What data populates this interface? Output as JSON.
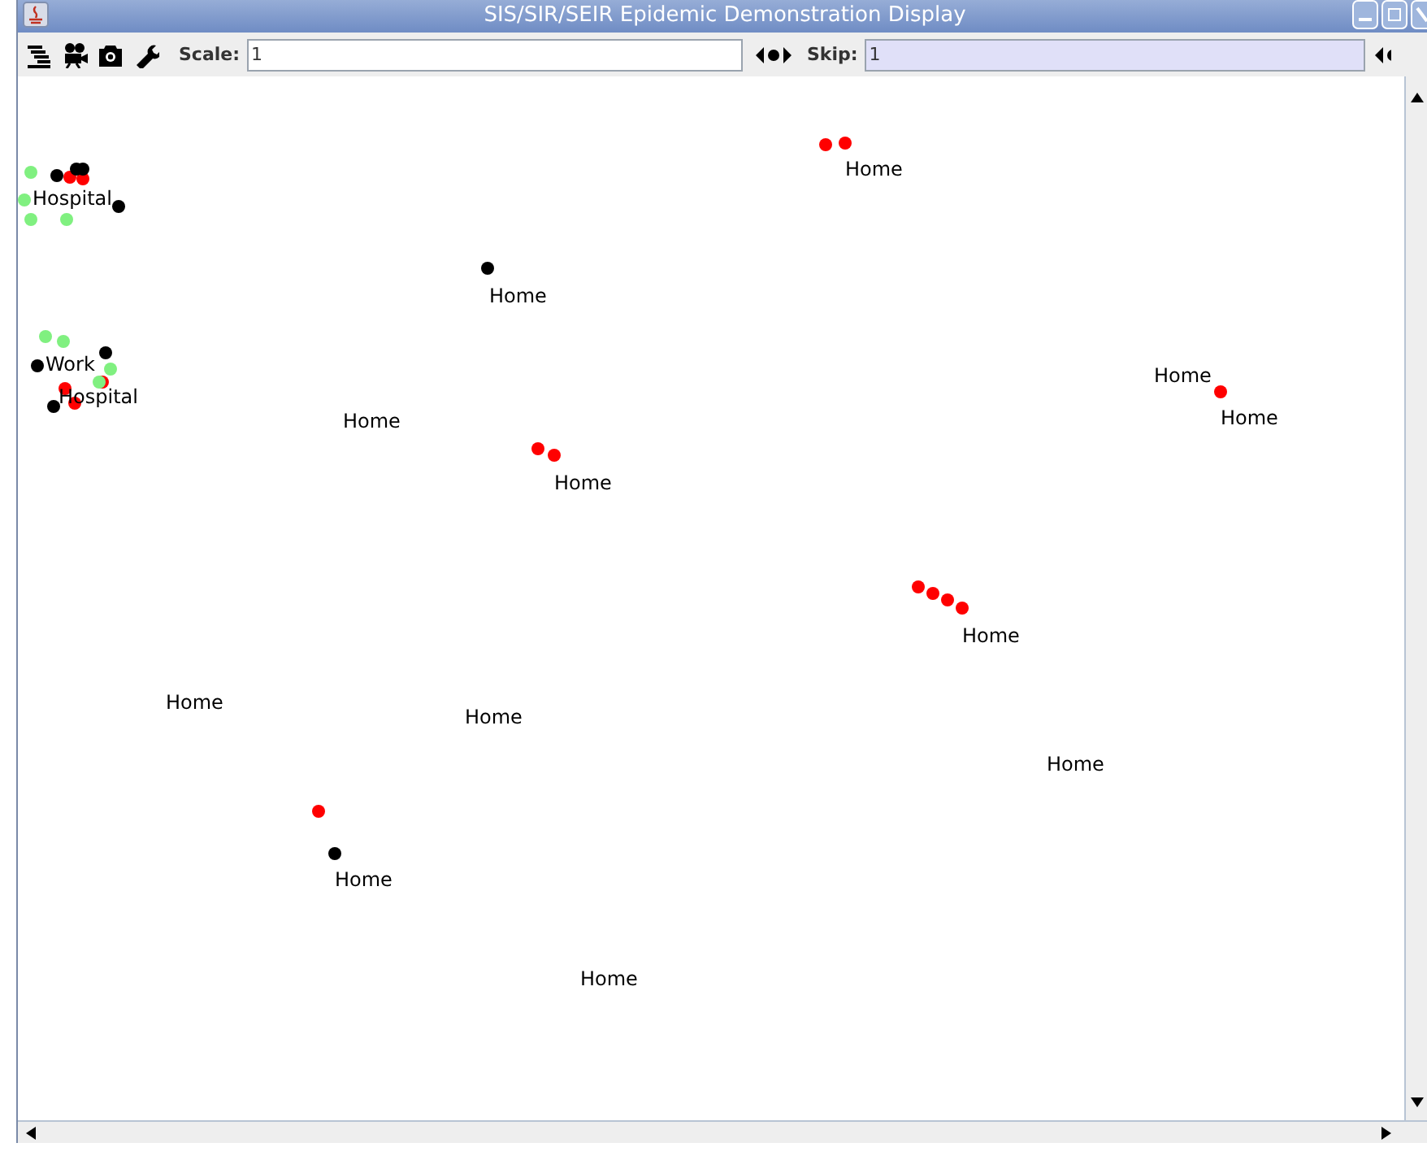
{
  "window": {
    "title": "SIS/SIR/SEIR Epidemic Demonstration Display"
  },
  "toolbar": {
    "scale_label": "Scale:",
    "scale_value": "1",
    "skip_label": "Skip:",
    "skip_value": "1",
    "skip_focused": true
  },
  "locations": [
    {
      "label": "Home"
    },
    {
      "label": "Hospital"
    },
    {
      "label": "Home"
    },
    {
      "label": "Work"
    },
    {
      "label": "Hospital"
    },
    {
      "label": "Home"
    },
    {
      "label": "Home"
    },
    {
      "label": "Home"
    },
    {
      "label": "Home"
    },
    {
      "label": "Home"
    },
    {
      "label": "Home"
    },
    {
      "label": "Home"
    },
    {
      "label": "Home"
    },
    {
      "label": "Home"
    },
    {
      "label": "Home"
    }
  ],
  "agents": [
    {
      "color": "#ff0000"
    },
    {
      "color": "#ff0000"
    },
    {
      "color": "#ff0000"
    },
    {
      "color": "#ff0000"
    },
    {
      "color": "#ff0000"
    },
    {
      "color": "#ff0000"
    },
    {
      "color": "#ff0000"
    },
    {
      "color": "#ff0000"
    },
    {
      "color": "#ff0000"
    },
    {
      "color": "#ff0000"
    },
    {
      "color": "#ff0000"
    },
    {
      "color": "#ff0000"
    },
    {
      "color": "#ff0000"
    },
    {
      "color": "#ff0000"
    },
    {
      "color": "#ff0000"
    },
    {
      "color": "#000000"
    },
    {
      "color": "#000000"
    },
    {
      "color": "#000000"
    },
    {
      "color": "#000000"
    },
    {
      "color": "#000000"
    },
    {
      "color": "#000000"
    },
    {
      "color": "#000000"
    },
    {
      "color": "#000000"
    },
    {
      "color": "#000000"
    },
    {
      "color": "#80f080"
    },
    {
      "color": "#80f080"
    },
    {
      "color": "#80f080"
    },
    {
      "color": "#80f080"
    },
    {
      "color": "#80f080"
    },
    {
      "color": "#80f080"
    },
    {
      "color": "#80f080"
    },
    {
      "color": "#80f080"
    }
  ]
}
